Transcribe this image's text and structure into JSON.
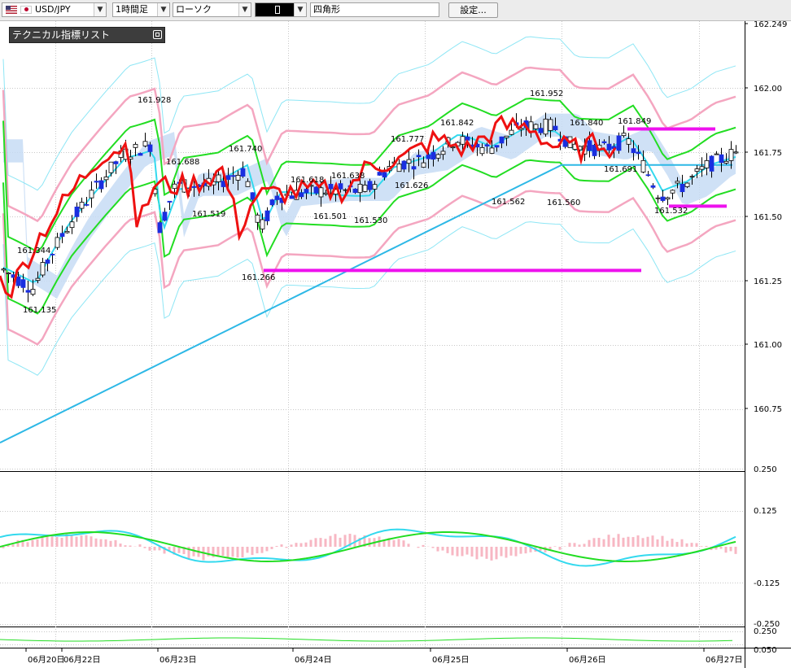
{
  "toolbar": {
    "symbol": "USD/JPY",
    "timeframe": "1時間足",
    "chart_type": "ローソク",
    "color_value": "",
    "drawing_tool": "四角形",
    "settings_label": "設定..."
  },
  "indicator_panel": {
    "title": "テクニカル指標リスト"
  },
  "colors": {
    "up_candle": "#ffffff",
    "down_candle": "#1a2fe0",
    "wick": "#000000",
    "bollinger": "#f4a6c0",
    "bollinger_outer": "#8ee6f5",
    "envelope": "#22dd22",
    "ma_cyan": "#33d9ee",
    "ma_long": "#2db8e6",
    "red_line": "#ee1111",
    "cloud": "#c7dcf5",
    "macd_hist": "#f7b7c3",
    "magenta": "#ee11ee"
  },
  "price_axis": {
    "labels": [
      "162.249",
      "162.00",
      "161.75",
      "161.50",
      "161.25",
      "161.00",
      "160.75"
    ]
  },
  "sub_axis": {
    "labels": [
      "0.250",
      "0.125",
      "-0.125",
      "-0.250"
    ]
  },
  "sub2_axis": {
    "labels": [
      "0.250",
      "0.050"
    ]
  },
  "date_axis": {
    "labels": [
      "06月20日",
      "06月22日",
      "06月23日",
      "06月24日",
      "06月25日",
      "06月26日",
      "06月27日"
    ]
  },
  "price_annotations": [
    "161.928",
    "161.688",
    "161.740",
    "161.519",
    "161.344",
    "161.135",
    "161.266",
    "161.618",
    "161.638",
    "161.501",
    "161.530",
    "161.777",
    "161.626",
    "161.842",
    "161.562",
    "161.952",
    "161.840",
    "161.849",
    "161.691",
    "161.560",
    "161.532"
  ],
  "chart_data": {
    "type": "line",
    "title": "",
    "xlabel": "",
    "ylabel": "",
    "ylim": [
      160.6,
      162.28
    ],
    "y_ticks": [
      162.0,
      161.75,
      161.5,
      161.25,
      161.0,
      160.75
    ],
    "x_dates": [
      "06月20日",
      "06月22日",
      "06月23日",
      "06月24日",
      "06月25日",
      "06月26日",
      "06月27日"
    ],
    "candlesticks": true,
    "annotations": [
      {
        "label": "161.928",
        "value": 161.928
      },
      {
        "label": "161.688",
        "value": 161.688
      },
      {
        "label": "161.740",
        "value": 161.74
      },
      {
        "label": "161.519",
        "value": 161.519
      },
      {
        "label": "161.344",
        "value": 161.344
      },
      {
        "label": "161.135",
        "value": 161.135
      },
      {
        "label": "161.266",
        "value": 161.266
      },
      {
        "label": "161.618",
        "value": 161.618
      },
      {
        "label": "161.638",
        "value": 161.638
      },
      {
        "label": "161.501",
        "value": 161.501
      },
      {
        "label": "161.530",
        "value": 161.53
      },
      {
        "label": "161.777",
        "value": 161.777
      },
      {
        "label": "161.626",
        "value": 161.626
      },
      {
        "label": "161.842",
        "value": 161.842
      },
      {
        "label": "161.562",
        "value": 161.562
      },
      {
        "label": "161.952",
        "value": 161.952
      },
      {
        "label": "161.840",
        "value": 161.84
      },
      {
        "label": "161.849",
        "value": 161.849
      },
      {
        "label": "161.691",
        "value": 161.691
      },
      {
        "label": "161.560",
        "value": 161.56
      },
      {
        "label": "161.532",
        "value": 161.532
      }
    ],
    "horizontal_lines": [
      {
        "value": 161.29,
        "color": "#ee11ee"
      },
      {
        "value": 161.84,
        "color": "#ee11ee"
      },
      {
        "value": 161.54,
        "color": "#ee11ee"
      }
    ],
    "grid": true
  }
}
